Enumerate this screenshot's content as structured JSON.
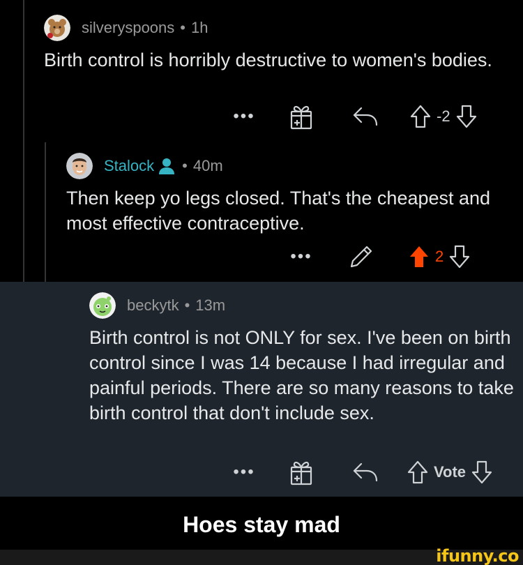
{
  "comments": [
    {
      "username": "silveryspoons",
      "time": "1h",
      "body": "Birth control is horribly destructive to women's bodies.",
      "vote": "-2"
    },
    {
      "username": "Stalock",
      "time": "40m",
      "body": "Then keep yo legs closed. That's the cheapest and most effective contraceptive.",
      "vote": "2"
    },
    {
      "username": "beckytk",
      "time": "13m",
      "body": "Birth control is not ONLY for sex. I've been on birth control since I was 14 because I had irregular and painful periods. There are so many reasons to take birth control that don't include sex.",
      "vote": "Vote"
    }
  ],
  "separator": "•",
  "more_label": "•••",
  "caption": "Hoes stay mad",
  "watermark": "ifunny.co",
  "colors": {
    "background": "#000000",
    "highlight_bg": "#1e252d",
    "upvote_active": "#ff4500",
    "mod_accent": "#37b4c4"
  },
  "icons": [
    "gift-icon",
    "reply-icon",
    "upvote-icon",
    "downvote-icon",
    "edit-icon",
    "mod-icon"
  ]
}
